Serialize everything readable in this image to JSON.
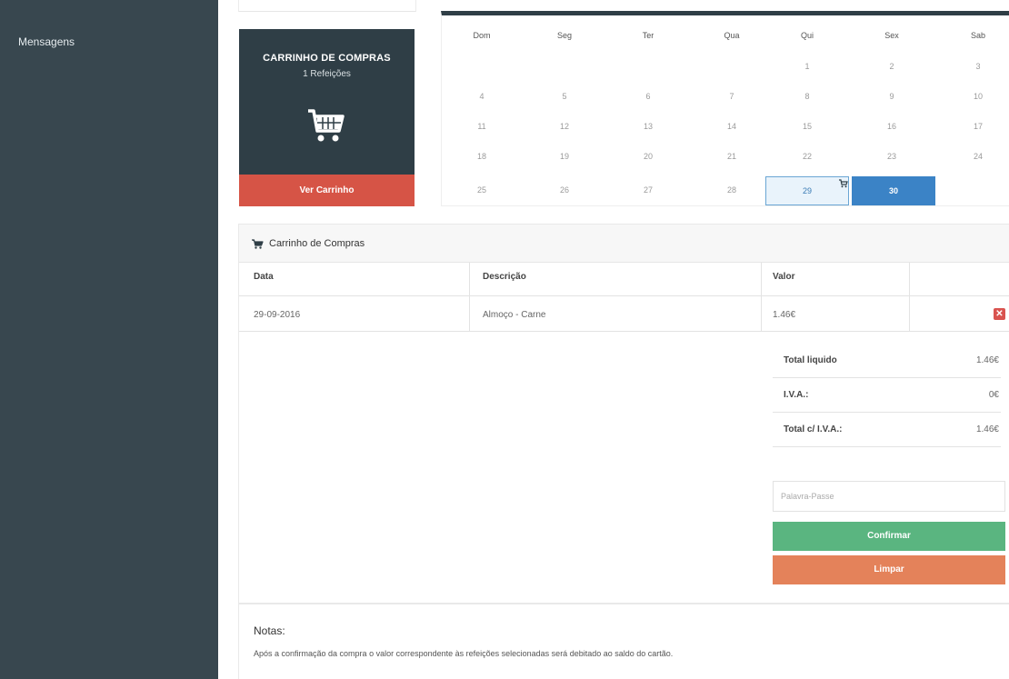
{
  "sidebar": {
    "items": [
      {
        "label": "Mensagens"
      }
    ]
  },
  "cart_widget": {
    "title": "CARRINHO DE COMPRAS",
    "count": "1 Refeições",
    "button_label": "Ver Carrinho",
    "icon": "shopping-cart-icon"
  },
  "calendar": {
    "weekdays": [
      "Dom",
      "Seg",
      "Ter",
      "Qua",
      "Qui",
      "Sex",
      "Sab"
    ],
    "weeks": [
      [
        "",
        "",
        "",
        "",
        "1",
        "2",
        "3"
      ],
      [
        "4",
        "5",
        "6",
        "7",
        "8",
        "9",
        "10"
      ],
      [
        "11",
        "12",
        "13",
        "14",
        "15",
        "16",
        "17"
      ],
      [
        "18",
        "19",
        "20",
        "21",
        "22",
        "23",
        "24"
      ],
      [
        "25",
        "26",
        "27",
        "28",
        "29",
        "30",
        ""
      ]
    ],
    "today": "29",
    "selected": "30"
  },
  "cart_panel": {
    "title": "Carrinho de Compras",
    "columns": [
      "Data",
      "Descrição",
      "Valor"
    ],
    "rows": [
      {
        "date": "29-09-2016",
        "description": "Almoço - Carne",
        "value": "1.46€"
      }
    ],
    "totals": [
      {
        "label": "Total liquido",
        "value": "1.46€"
      },
      {
        "label": "I.V.A.:",
        "value": "0€"
      },
      {
        "label": "Total c/ I.V.A.:",
        "value": "1.46€"
      }
    ],
    "password_placeholder": "Palavra-Passe",
    "confirm_label": "Confirmar",
    "clear_label": "Limpar"
  },
  "notes": {
    "title": "Notas:",
    "text": "Após a confirmação da compra o valor correspondente às refeições selecionadas será debitado ao saldo do cartão."
  },
  "colors": {
    "sidebar_bg": "#38474f",
    "widget_bg": "#2f3e46",
    "danger": "#d65446",
    "primary": "#3b83c6",
    "success": "#5ab580",
    "warning": "#e4825a"
  }
}
